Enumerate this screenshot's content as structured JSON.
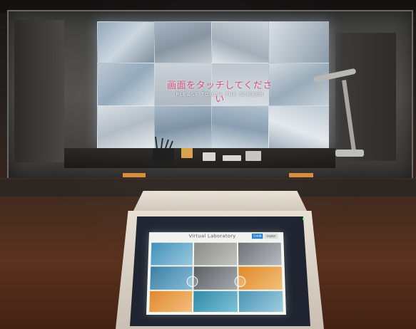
{
  "projection": {
    "title_jp": "画面をタッチしてください",
    "title_en": "PLEASE TOUCH THE SCREEN"
  },
  "kiosk": {
    "screen_title": "Virtual Laboratory",
    "lang_jp_label": "日本語",
    "lang_en_label": "English",
    "tiles": [
      {
        "label": "",
        "color": "#3f90b8"
      },
      {
        "label": "",
        "color": "#8a8a86"
      },
      {
        "label": "",
        "color": "#6d7175"
      },
      {
        "label": "",
        "color": "#3b7fa5"
      },
      {
        "label": "",
        "color": "#e08a2e"
      },
      {
        "label": "",
        "color": "#4f9c86"
      },
      {
        "label": "",
        "color": "#2f8aa8"
      },
      {
        "label": "",
        "color": "#e0892a"
      },
      {
        "label": "",
        "color": "#4a94b3"
      }
    ]
  },
  "colors": {
    "projection_title": "#d84c7a",
    "kiosk_bezel": "#1f2430",
    "led": "#7cff77"
  }
}
